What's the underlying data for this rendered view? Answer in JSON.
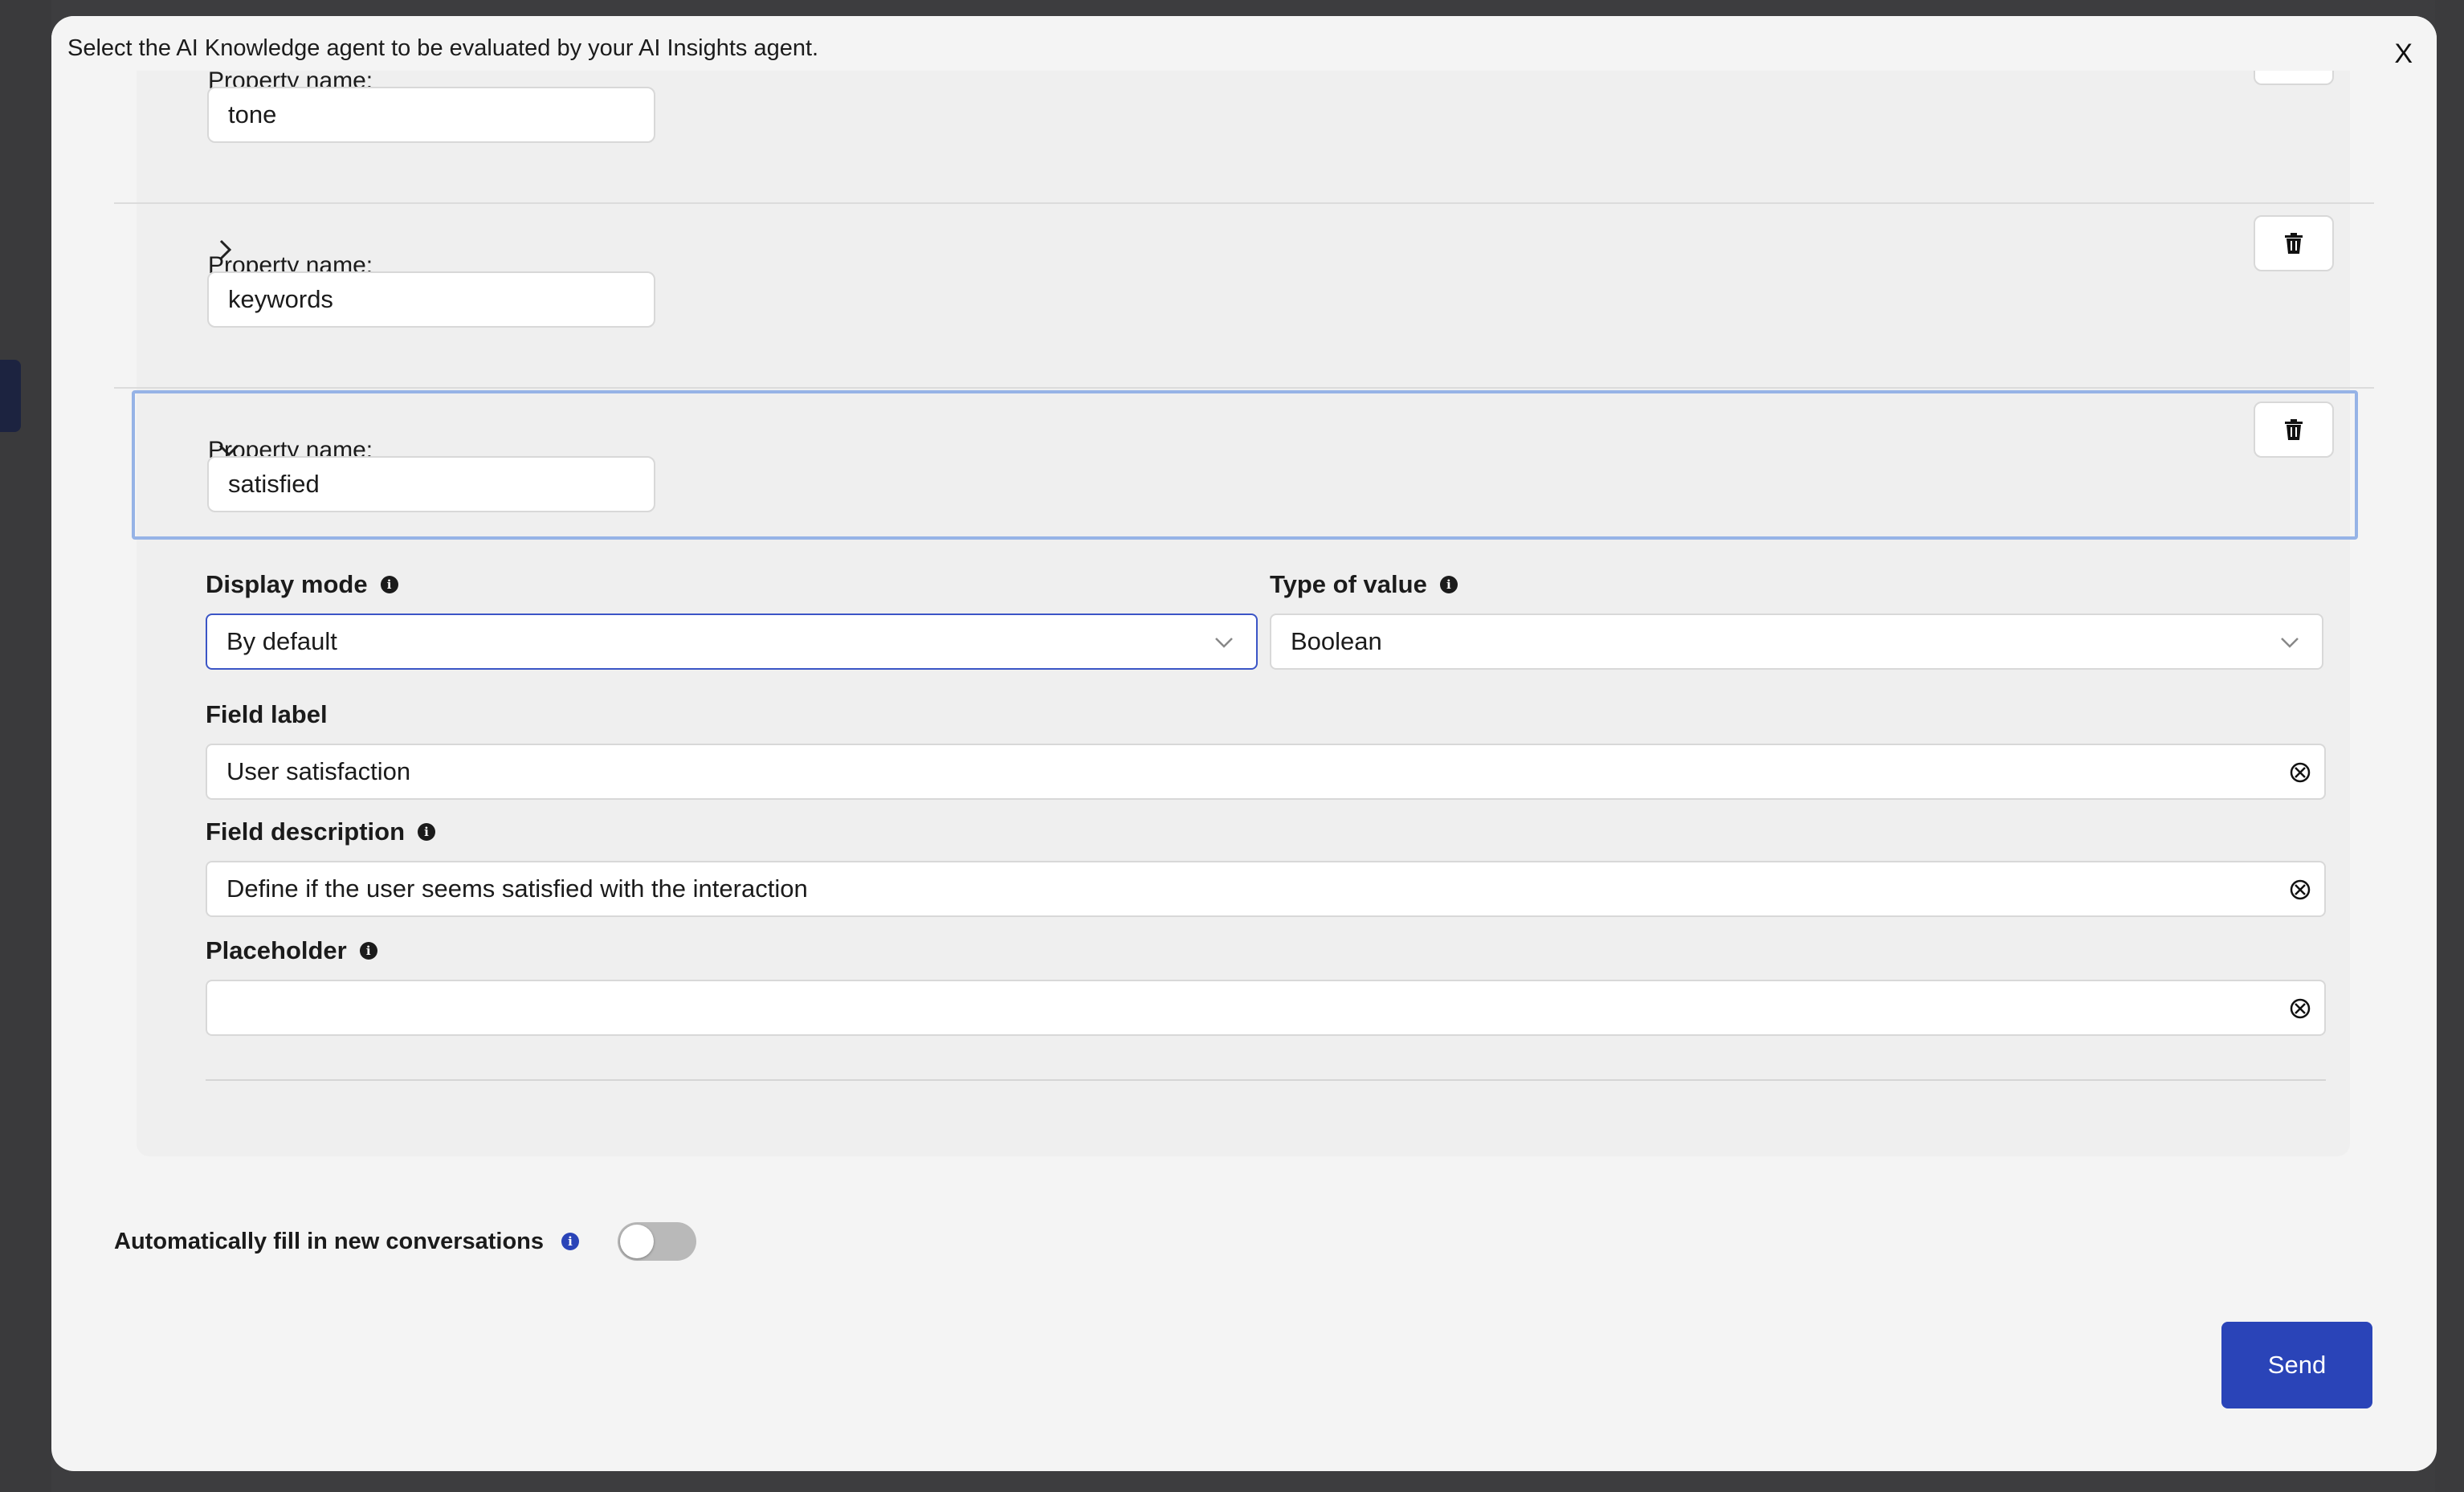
{
  "modal": {
    "subtitle": "Select the AI Knowledge agent to be evaluated by your AI Insights agent.",
    "close_label": "X"
  },
  "properties": [
    {
      "label": "Property name:",
      "value": "tone",
      "expanded": false
    },
    {
      "label": "Property name:",
      "value": "keywords",
      "expanded": false
    },
    {
      "label": "Property name:",
      "value": "satisfied",
      "expanded": true
    }
  ],
  "details": {
    "display_mode": {
      "label": "Display mode",
      "value": "By default"
    },
    "type_of_value": {
      "label": "Type of value",
      "value": "Boolean"
    },
    "field_label": {
      "label": "Field label",
      "value": "User satisfaction"
    },
    "field_description": {
      "label": "Field description",
      "value": "Define if the user seems satisfied with the interaction"
    },
    "placeholder": {
      "label": "Placeholder",
      "value": ""
    }
  },
  "auto_fill": {
    "label": "Automatically fill in new conversations",
    "enabled": false
  },
  "send_label": "Send",
  "colors": {
    "accent": "#2a44b8",
    "selected_outline": "#96b3e6"
  },
  "icons": [
    "close-icon",
    "chevron-right-icon",
    "chevron-down-icon",
    "trash-icon",
    "info-icon",
    "clear-icon",
    "toggle"
  ]
}
